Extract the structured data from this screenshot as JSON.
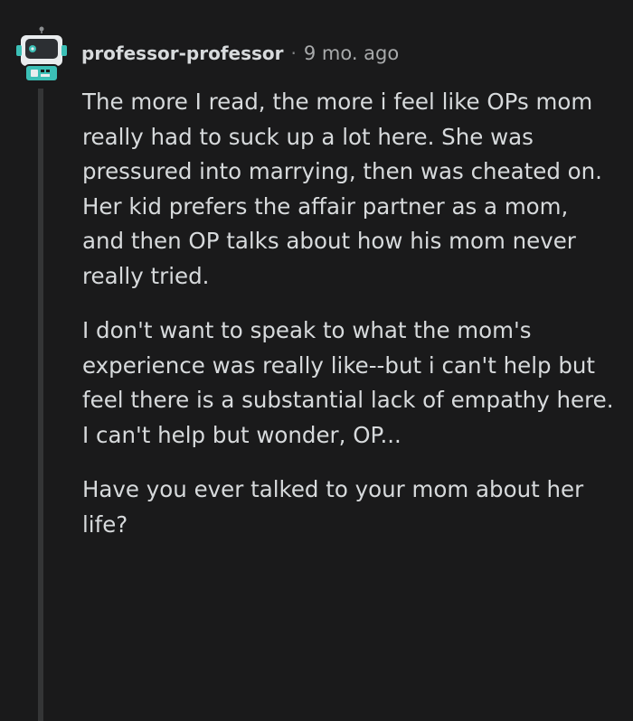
{
  "comment": {
    "username": "professor-professor",
    "separator": "·",
    "timestamp": "9 mo. ago",
    "avatar_icon": "robot-avatar-icon",
    "paragraphs": [
      "The more I read, the more i feel like OPs mom really had to suck up a lot here. She was pressured into marrying, then was cheated on. Her kid prefers the affair partner as a mom, and then OP talks about how his mom never really tried.",
      "I don't want to speak to what the mom's experience was really like--but i can't help but feel there is a substantial lack of empathy here. I can't help but wonder, OP...",
      "Have you ever talked to your mom about her life?"
    ]
  },
  "colors": {
    "background": "#1a1a1b",
    "text": "#d7dadc",
    "meta": "#a8aaab",
    "thread_line": "#343536",
    "avatar_accent": "#3bbfb6"
  }
}
